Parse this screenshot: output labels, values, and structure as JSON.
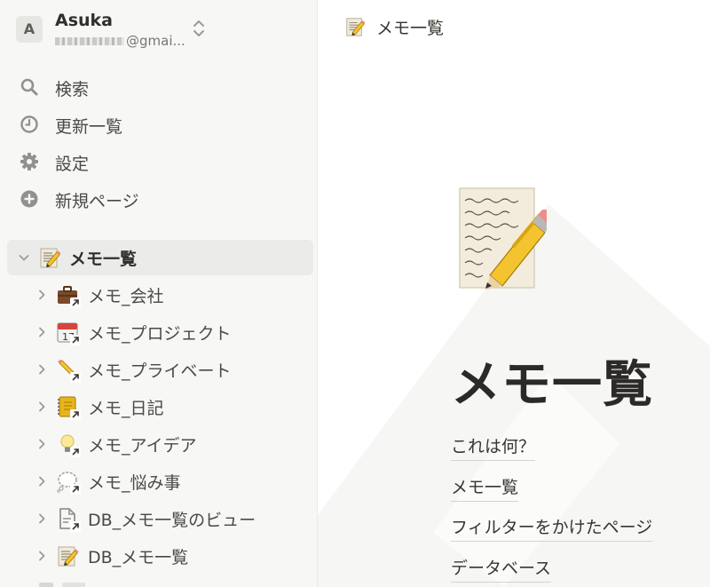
{
  "workspace": {
    "avatar_letter": "A",
    "name": "Asuka",
    "email_visible": "@gmai..."
  },
  "nav": [
    {
      "label": "検索",
      "icon": "search-icon"
    },
    {
      "label": "更新一覧",
      "icon": "clock-icon"
    },
    {
      "label": "設定",
      "icon": "gear-icon"
    },
    {
      "label": "新規ページ",
      "icon": "plus-circle-icon"
    }
  ],
  "pages": {
    "root": {
      "label": "メモ一覧",
      "icon": "memo-icon"
    },
    "children": [
      {
        "label": "メモ_会社",
        "icon": "briefcase-icon"
      },
      {
        "label": "メモ_プロジェクト",
        "icon": "calendar-icon"
      },
      {
        "label": "メモ_プライベート",
        "icon": "pencil-icon"
      },
      {
        "label": "メモ_日記",
        "icon": "notebook-icon"
      },
      {
        "label": "メモ_アイデア",
        "icon": "lightbulb-icon"
      },
      {
        "label": "メモ_悩み事",
        "icon": "thought-balloon-icon"
      },
      {
        "label": "DB_メモ一覧のビュー",
        "icon": "document-icon"
      },
      {
        "label": "DB_メモ一覧",
        "icon": "memo-icon"
      }
    ]
  },
  "main": {
    "breadcrumb": "メモ一覧",
    "title": "メモ一覧",
    "links": [
      "これは何？",
      "メモ一覧",
      "フィルターをかけたページ",
      "データベース"
    ]
  }
}
